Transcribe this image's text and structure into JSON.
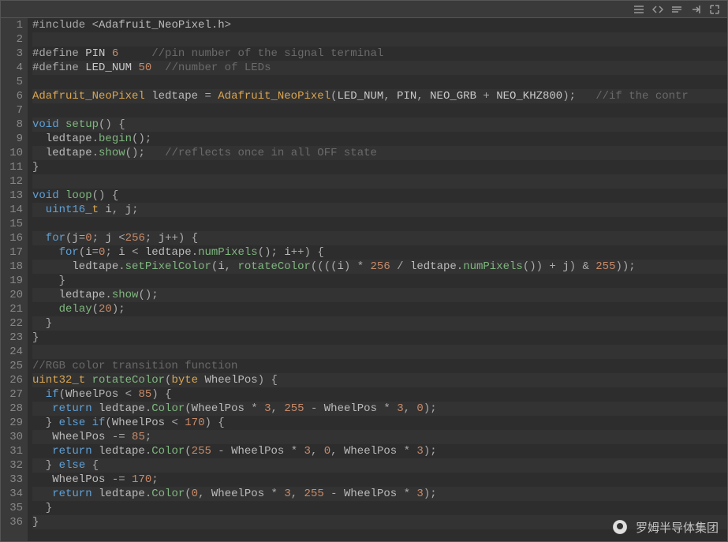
{
  "toolbar": {
    "icons": [
      "menu-icon",
      "code-icon",
      "wrap-icon",
      "export-icon",
      "expand-icon"
    ]
  },
  "watermark": {
    "text": "罗姆半导体集团"
  },
  "code": {
    "lines": [
      {
        "n": 1,
        "tokens": [
          [
            "pp",
            "#include "
          ],
          [
            "op",
            "<"
          ],
          [
            "id",
            "Adafruit_NeoPixel"
          ],
          [
            "pun",
            "."
          ],
          [
            "id",
            "h"
          ],
          [
            "op",
            ">"
          ]
        ]
      },
      {
        "n": 2,
        "tokens": []
      },
      {
        "n": 3,
        "tokens": [
          [
            "pp",
            "#define "
          ],
          [
            "const",
            "PIN "
          ],
          [
            "num",
            "6"
          ],
          [
            "pp",
            "     "
          ],
          [
            "cm",
            "//pin number of the signal terminal"
          ]
        ]
      },
      {
        "n": 4,
        "tokens": [
          [
            "pp",
            "#define "
          ],
          [
            "const",
            "LED_NUM "
          ],
          [
            "num",
            "50"
          ],
          [
            "pp",
            "  "
          ],
          [
            "cm",
            "//number of LEDs"
          ]
        ]
      },
      {
        "n": 5,
        "tokens": []
      },
      {
        "n": 6,
        "tokens": [
          [
            "type",
            "Adafruit_NeoPixel"
          ],
          [
            "id",
            " ledtape "
          ],
          [
            "op",
            "= "
          ],
          [
            "type",
            "Adafruit_NeoPixel"
          ],
          [
            "pun",
            "("
          ],
          [
            "const",
            "LED_NUM"
          ],
          [
            "pun",
            ", "
          ],
          [
            "const",
            "PIN"
          ],
          [
            "pun",
            ", "
          ],
          [
            "const",
            "NEO_GRB"
          ],
          [
            "op",
            " + "
          ],
          [
            "const",
            "NEO_KHZ800"
          ],
          [
            "pun",
            ");   "
          ],
          [
            "cm",
            "//if the contr"
          ]
        ]
      },
      {
        "n": 7,
        "tokens": []
      },
      {
        "n": 8,
        "tokens": [
          [
            "kw",
            "void"
          ],
          [
            "id",
            " "
          ],
          [
            "fn",
            "setup"
          ],
          [
            "pun",
            "() {"
          ]
        ]
      },
      {
        "n": 9,
        "tokens": [
          [
            "id",
            "  ledtape"
          ],
          [
            "pun",
            "."
          ],
          [
            "fn",
            "begin"
          ],
          [
            "pun",
            "();"
          ]
        ]
      },
      {
        "n": 10,
        "tokens": [
          [
            "id",
            "  ledtape"
          ],
          [
            "pun",
            "."
          ],
          [
            "fn",
            "show"
          ],
          [
            "pun",
            "();   "
          ],
          [
            "cm",
            "//reflects once in all OFF state"
          ]
        ]
      },
      {
        "n": 11,
        "tokens": [
          [
            "pun",
            "}"
          ]
        ]
      },
      {
        "n": 12,
        "tokens": []
      },
      {
        "n": 13,
        "tokens": [
          [
            "kw",
            "void"
          ],
          [
            "id",
            " "
          ],
          [
            "fn",
            "loop"
          ],
          [
            "pun",
            "() {"
          ]
        ]
      },
      {
        "n": 14,
        "tokens": [
          [
            "kw",
            "  uint16"
          ],
          [
            "type",
            "_t"
          ],
          [
            "id",
            " i"
          ],
          [
            "pun",
            ", "
          ],
          [
            "id",
            "j"
          ],
          [
            "pun",
            ";"
          ]
        ]
      },
      {
        "n": 15,
        "tokens": []
      },
      {
        "n": 16,
        "tokens": [
          [
            "kw",
            "  for"
          ],
          [
            "pun",
            "("
          ],
          [
            "id",
            "j"
          ],
          [
            "op",
            "="
          ],
          [
            "num",
            "0"
          ],
          [
            "pun",
            "; "
          ],
          [
            "id",
            "j "
          ],
          [
            "op",
            "<"
          ],
          [
            "num",
            "256"
          ],
          [
            "pun",
            "; "
          ],
          [
            "id",
            "j"
          ],
          [
            "op",
            "++"
          ],
          [
            "pun",
            ") {"
          ]
        ]
      },
      {
        "n": 17,
        "tokens": [
          [
            "kw",
            "    for"
          ],
          [
            "pun",
            "("
          ],
          [
            "id",
            "i"
          ],
          [
            "op",
            "="
          ],
          [
            "num",
            "0"
          ],
          [
            "pun",
            "; "
          ],
          [
            "id",
            "i "
          ],
          [
            "op",
            "< "
          ],
          [
            "id",
            "ledtape"
          ],
          [
            "pun",
            "."
          ],
          [
            "fn",
            "numPixels"
          ],
          [
            "pun",
            "(); "
          ],
          [
            "id",
            "i"
          ],
          [
            "op",
            "++"
          ],
          [
            "pun",
            ") {"
          ]
        ]
      },
      {
        "n": 18,
        "tokens": [
          [
            "id",
            "      ledtape"
          ],
          [
            "pun",
            "."
          ],
          [
            "fn",
            "setPixelColor"
          ],
          [
            "pun",
            "("
          ],
          [
            "id",
            "i"
          ],
          [
            "pun",
            ", "
          ],
          [
            "fn",
            "rotateColor"
          ],
          [
            "pun",
            "(((("
          ],
          [
            "id",
            "i"
          ],
          [
            "pun",
            ") "
          ],
          [
            "op",
            "* "
          ],
          [
            "num",
            "256"
          ],
          [
            "op",
            " / "
          ],
          [
            "id",
            "ledtape"
          ],
          [
            "pun",
            "."
          ],
          [
            "fn",
            "numPixels"
          ],
          [
            "pun",
            "()) "
          ],
          [
            "op",
            "+ "
          ],
          [
            "id",
            "j"
          ],
          [
            "pun",
            ") "
          ],
          [
            "op",
            "& "
          ],
          [
            "num",
            "255"
          ],
          [
            "pun",
            "));"
          ]
        ]
      },
      {
        "n": 19,
        "tokens": [
          [
            "pun",
            "    }"
          ]
        ]
      },
      {
        "n": 20,
        "tokens": [
          [
            "id",
            "    ledtape"
          ],
          [
            "pun",
            "."
          ],
          [
            "fn",
            "show"
          ],
          [
            "pun",
            "();"
          ]
        ]
      },
      {
        "n": 21,
        "tokens": [
          [
            "id",
            "    "
          ],
          [
            "fn",
            "delay"
          ],
          [
            "pun",
            "("
          ],
          [
            "num",
            "20"
          ],
          [
            "pun",
            ");"
          ]
        ]
      },
      {
        "n": 22,
        "tokens": [
          [
            "pun",
            "  }"
          ]
        ]
      },
      {
        "n": 23,
        "tokens": [
          [
            "pun",
            "}"
          ]
        ]
      },
      {
        "n": 24,
        "tokens": []
      },
      {
        "n": 25,
        "tokens": [
          [
            "cm",
            "//RGB color transition function"
          ]
        ]
      },
      {
        "n": 26,
        "tokens": [
          [
            "type",
            "uint32_t"
          ],
          [
            "id",
            " "
          ],
          [
            "fn",
            "rotateColor"
          ],
          [
            "pun",
            "("
          ],
          [
            "type",
            "byte"
          ],
          [
            "id",
            " WheelPos"
          ],
          [
            "pun",
            ") {"
          ]
        ]
      },
      {
        "n": 27,
        "tokens": [
          [
            "kw",
            "  if"
          ],
          [
            "pun",
            "("
          ],
          [
            "id",
            "WheelPos "
          ],
          [
            "op",
            "< "
          ],
          [
            "num",
            "85"
          ],
          [
            "pun",
            ") {"
          ]
        ]
      },
      {
        "n": 28,
        "tokens": [
          [
            "kw",
            "   return"
          ],
          [
            "id",
            " ledtape"
          ],
          [
            "pun",
            "."
          ],
          [
            "fn",
            "Color"
          ],
          [
            "pun",
            "("
          ],
          [
            "id",
            "WheelPos "
          ],
          [
            "op",
            "* "
          ],
          [
            "num",
            "3"
          ],
          [
            "pun",
            ", "
          ],
          [
            "num",
            "255"
          ],
          [
            "op",
            " - "
          ],
          [
            "id",
            "WheelPos "
          ],
          [
            "op",
            "* "
          ],
          [
            "num",
            "3"
          ],
          [
            "pun",
            ", "
          ],
          [
            "num",
            "0"
          ],
          [
            "pun",
            ");"
          ]
        ]
      },
      {
        "n": 29,
        "tokens": [
          [
            "pun",
            "  } "
          ],
          [
            "kw",
            "else if"
          ],
          [
            "pun",
            "("
          ],
          [
            "id",
            "WheelPos "
          ],
          [
            "op",
            "< "
          ],
          [
            "num",
            "170"
          ],
          [
            "pun",
            ") {"
          ]
        ]
      },
      {
        "n": 30,
        "tokens": [
          [
            "id",
            "   WheelPos "
          ],
          [
            "op",
            "-= "
          ],
          [
            "num",
            "85"
          ],
          [
            "pun",
            ";"
          ]
        ]
      },
      {
        "n": 31,
        "tokens": [
          [
            "kw",
            "   return"
          ],
          [
            "id",
            " ledtape"
          ],
          [
            "pun",
            "."
          ],
          [
            "fn",
            "Color"
          ],
          [
            "pun",
            "("
          ],
          [
            "num",
            "255"
          ],
          [
            "op",
            " - "
          ],
          [
            "id",
            "WheelPos "
          ],
          [
            "op",
            "* "
          ],
          [
            "num",
            "3"
          ],
          [
            "pun",
            ", "
          ],
          [
            "num",
            "0"
          ],
          [
            "pun",
            ", "
          ],
          [
            "id",
            "WheelPos "
          ],
          [
            "op",
            "* "
          ],
          [
            "num",
            "3"
          ],
          [
            "pun",
            ");"
          ]
        ]
      },
      {
        "n": 32,
        "tokens": [
          [
            "pun",
            "  } "
          ],
          [
            "kw",
            "else"
          ],
          [
            "pun",
            " {"
          ]
        ]
      },
      {
        "n": 33,
        "tokens": [
          [
            "id",
            "   WheelPos "
          ],
          [
            "op",
            "-= "
          ],
          [
            "num",
            "170"
          ],
          [
            "pun",
            ";"
          ]
        ]
      },
      {
        "n": 34,
        "tokens": [
          [
            "kw",
            "   return"
          ],
          [
            "id",
            " ledtape"
          ],
          [
            "pun",
            "."
          ],
          [
            "fn",
            "Color"
          ],
          [
            "pun",
            "("
          ],
          [
            "num",
            "0"
          ],
          [
            "pun",
            ", "
          ],
          [
            "id",
            "WheelPos "
          ],
          [
            "op",
            "* "
          ],
          [
            "num",
            "3"
          ],
          [
            "pun",
            ", "
          ],
          [
            "num",
            "255"
          ],
          [
            "op",
            " - "
          ],
          [
            "id",
            "WheelPos "
          ],
          [
            "op",
            "* "
          ],
          [
            "num",
            "3"
          ],
          [
            "pun",
            ");"
          ]
        ]
      },
      {
        "n": 35,
        "tokens": [
          [
            "pun",
            "  }"
          ]
        ]
      },
      {
        "n": 36,
        "tokens": [
          [
            "pun",
            "}"
          ]
        ]
      }
    ]
  }
}
